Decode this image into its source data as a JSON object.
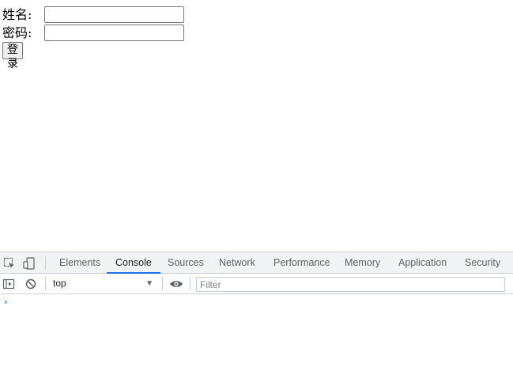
{
  "form": {
    "name_label": "姓名:",
    "name_value": "",
    "password_label": "密码:",
    "password_value": "",
    "login_button": "登录"
  },
  "devtools": {
    "icons": [
      "inspect-element-icon",
      "device-toolbar-icon"
    ],
    "tabs": [
      {
        "label": "Elements"
      },
      {
        "label": "Console",
        "active": true
      },
      {
        "label": "Sources"
      },
      {
        "label": "Network"
      },
      {
        "label": "Performance"
      },
      {
        "label": "Memory"
      },
      {
        "label": "Application"
      },
      {
        "label": "Security"
      }
    ],
    "toolbar": {
      "icons": [
        "sidebar-toggle-icon",
        "clear-console-icon",
        "eye-icon"
      ],
      "context": "top",
      "filter_placeholder": "Filter"
    },
    "prompt": "›",
    "accent_color": "#1a73e8"
  }
}
